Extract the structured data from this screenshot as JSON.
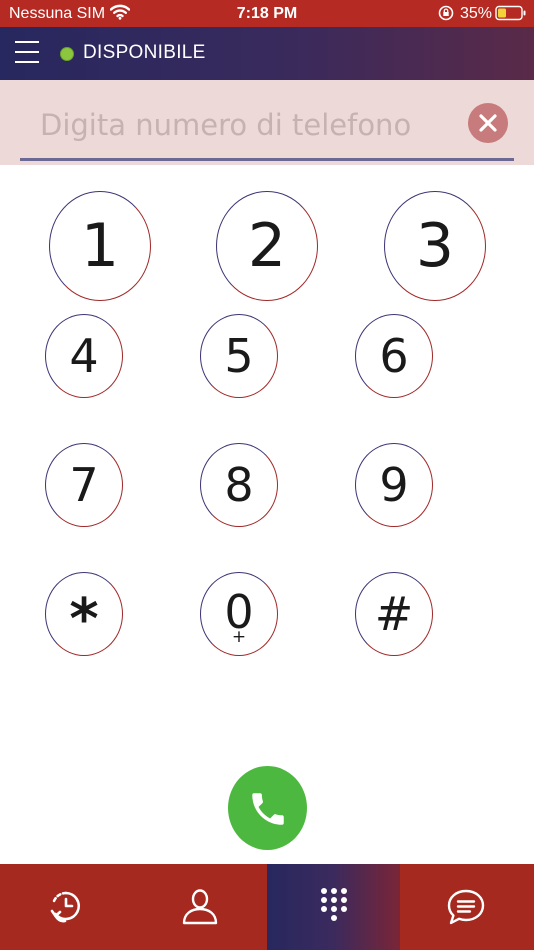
{
  "status_bar": {
    "carrier": "Nessuna SIM",
    "time": "7:18 PM",
    "battery_percent": "35%"
  },
  "header": {
    "presence_label": "DISPONIBILE",
    "presence_color": "#8cc63f"
  },
  "dialer": {
    "input_placeholder": "Digita numero di telefono",
    "input_value": ""
  },
  "keypad": {
    "keys": [
      {
        "label": "1",
        "sub": ""
      },
      {
        "label": "2",
        "sub": ""
      },
      {
        "label": "3",
        "sub": ""
      },
      {
        "label": "4",
        "sub": ""
      },
      {
        "label": "5",
        "sub": ""
      },
      {
        "label": "6",
        "sub": ""
      },
      {
        "label": "7",
        "sub": ""
      },
      {
        "label": "8",
        "sub": ""
      },
      {
        "label": "9",
        "sub": ""
      },
      {
        "label": "*",
        "sub": ""
      },
      {
        "label": "0",
        "sub": "+"
      },
      {
        "label": "#",
        "sub": ""
      }
    ]
  },
  "call": {
    "icon": "phone-icon",
    "color": "#4db83f"
  },
  "tabs": [
    {
      "icon": "history-icon",
      "active": false
    },
    {
      "icon": "contacts-icon",
      "active": false
    },
    {
      "icon": "keypad-icon",
      "active": true
    },
    {
      "icon": "chat-icon",
      "active": false
    }
  ],
  "colors": {
    "status_bar": "#b52a22",
    "header_start": "#27285f",
    "header_end": "#5a2a48",
    "input_background": "#edd9d7",
    "tab_bar": "#a6291f"
  }
}
